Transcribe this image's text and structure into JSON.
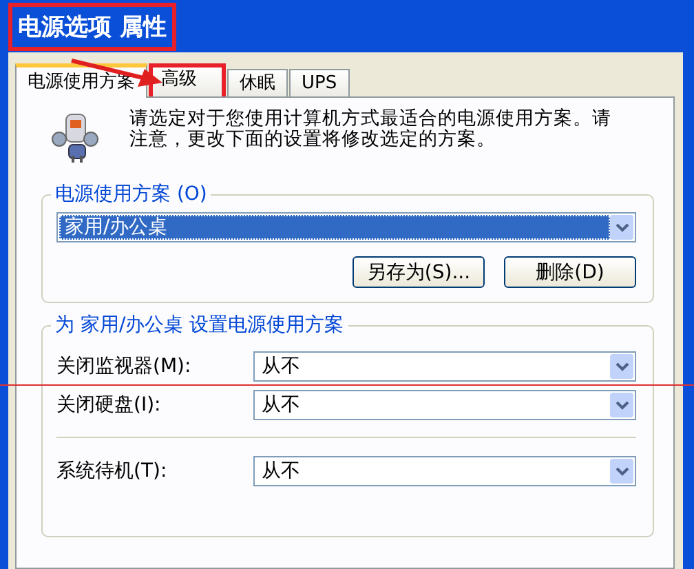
{
  "window": {
    "title": "电源选项 属性",
    "highlighted": true
  },
  "tabs": [
    {
      "label": "电源使用方案",
      "selected": true,
      "highlighted": false
    },
    {
      "label": "高级",
      "selected": false,
      "highlighted": true
    },
    {
      "label": "休眠",
      "selected": false,
      "highlighted": false
    },
    {
      "label": "UPS",
      "selected": false,
      "highlighted": false
    }
  ],
  "description": "请选定对于您使用计算机方式最适合的电源使用方案。请注意，更改下面的设置将修改选定的方案。",
  "scheme_group": {
    "title": "电源使用方案 (O)",
    "value": "家用/办公桌",
    "focused": true,
    "buttons": [
      "另存为(S)...",
      "删除(D)"
    ]
  },
  "settings_group": {
    "title": "为 家用/办公桌 设置电源使用方案",
    "rows": [
      {
        "label": "关闭监视器(M):",
        "value": "从不",
        "separator_before": false
      },
      {
        "label": "关闭硬盘(I):",
        "value": "从不",
        "separator_before": false
      },
      {
        "label": "系统待机(T):",
        "value": "从不",
        "separator_before": true
      }
    ]
  }
}
